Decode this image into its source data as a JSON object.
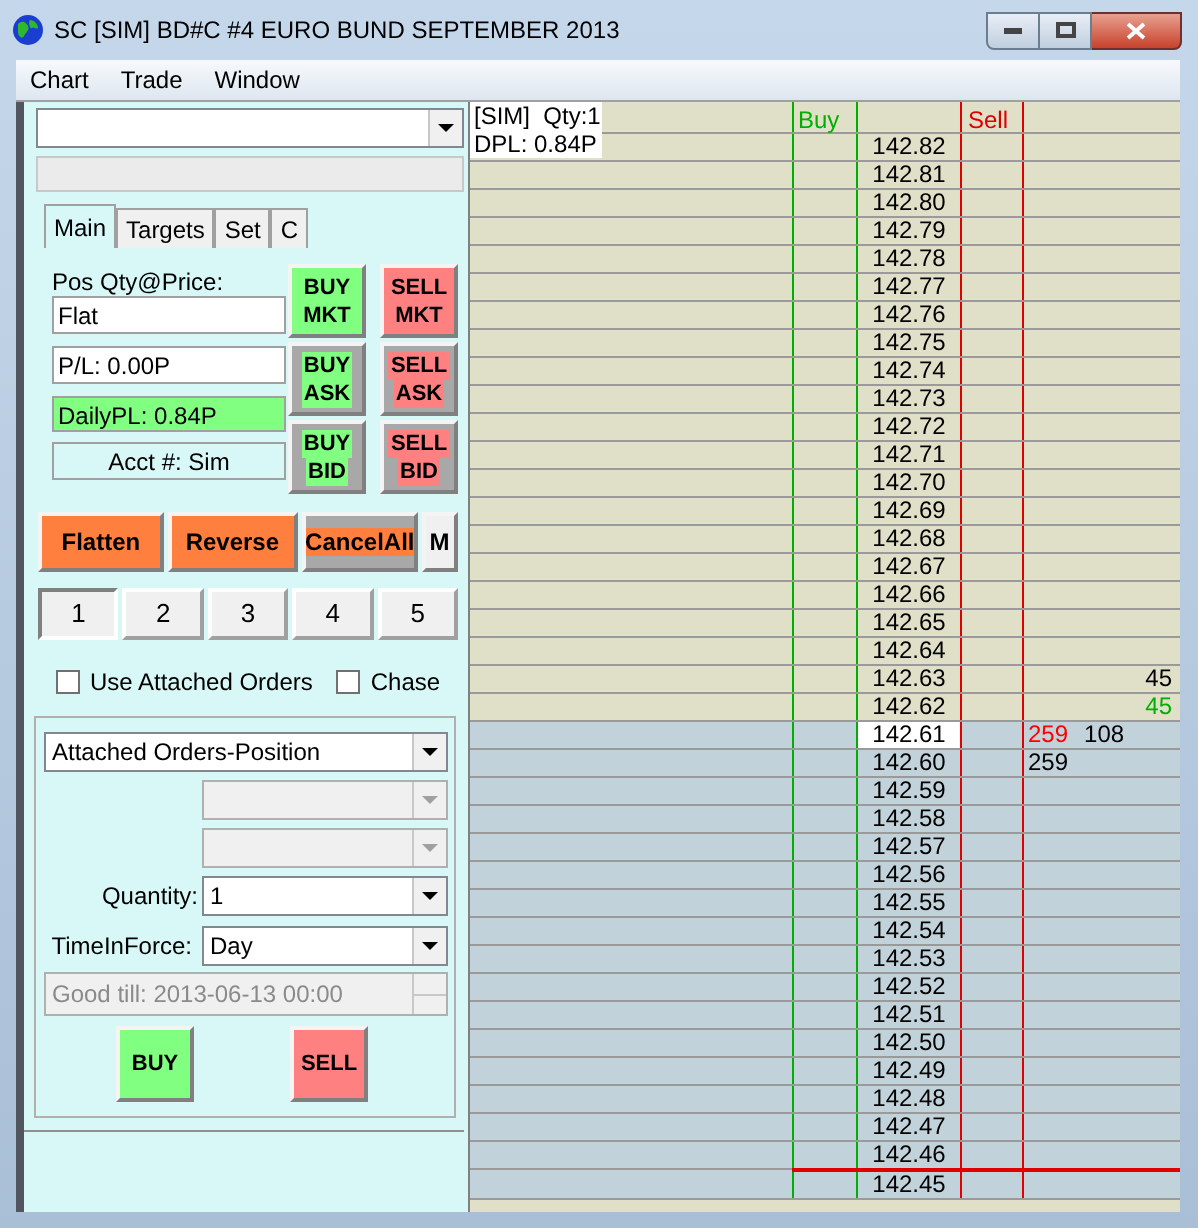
{
  "window": {
    "title": "SC [SIM] BD#C  #4  EURO BUND SEPTEMBER 2013"
  },
  "menu": [
    "Chart",
    "Trade",
    "Window"
  ],
  "left_panel": {
    "tabs": [
      {
        "label": "Main",
        "selected": true
      },
      {
        "label": "Targets",
        "selected": false
      },
      {
        "label": "Set",
        "selected": false
      },
      {
        "label": "C",
        "selected": false
      }
    ],
    "position_label": "Pos Qty@Price:",
    "position_value": "Flat",
    "pl": "P/L: 0.00P",
    "daily_pl": "DailyPL: 0.84P",
    "account": "Acct #: Sim",
    "order_buttons": [
      {
        "lines": [
          "BUY",
          "MKT"
        ],
        "kind": "buy_solid"
      },
      {
        "lines": [
          "SELL",
          "MKT"
        ],
        "kind": "sell_solid"
      },
      {
        "lines": [
          "BUY",
          "ASK"
        ],
        "kind": "buy_highlight"
      },
      {
        "lines": [
          "SELL",
          "ASK"
        ],
        "kind": "sell_highlight"
      },
      {
        "lines": [
          "BUY",
          "BID"
        ],
        "kind": "buy_highlight"
      },
      {
        "lines": [
          "SELL",
          "BID"
        ],
        "kind": "sell_highlight"
      }
    ],
    "action_buttons": [
      {
        "label": "Flatten",
        "kind": "solid"
      },
      {
        "label": "Reverse",
        "kind": "solid"
      },
      {
        "label": "CancelAll",
        "kind": "highlight"
      },
      {
        "label": "M",
        "kind": "plain"
      }
    ],
    "quantity_presets": [
      {
        "label": "1",
        "selected": true
      },
      {
        "label": "2",
        "selected": false
      },
      {
        "label": "3",
        "selected": false
      },
      {
        "label": "4",
        "selected": false
      },
      {
        "label": "5",
        "selected": false
      }
    ],
    "checkboxes": [
      {
        "label": "Use Attached Orders",
        "checked": false
      },
      {
        "label": "Chase",
        "checked": false
      }
    ],
    "attached_orders": {
      "value": "Attached Orders-Position",
      "extra_combos": [
        {
          "disabled": true
        },
        {
          "disabled": true
        }
      ],
      "quantity_label": "Quantity:",
      "quantity_value": "1",
      "tif_label": "TimeInForce:",
      "tif_value": "Day",
      "good_till": "Good till: 2013-06-13 00:00",
      "good_till_disabled": true,
      "buy": "BUY",
      "sell": "SELL"
    }
  },
  "ladder": {
    "info": [
      "[SIM]  Qty:1",
      "DPL: 0.84P"
    ],
    "buy_header": "Buy",
    "sell_header": "Sell",
    "rows": [
      {
        "price": "142.82",
        "kind": "ask",
        "current": false,
        "line_below": false
      },
      {
        "price": "142.81",
        "kind": "ask",
        "current": false,
        "line_below": false
      },
      {
        "price": "142.80",
        "kind": "ask",
        "current": false,
        "line_below": false
      },
      {
        "price": "142.79",
        "kind": "ask",
        "current": false,
        "line_below": false
      },
      {
        "price": "142.78",
        "kind": "ask",
        "current": false,
        "line_below": false
      },
      {
        "price": "142.77",
        "kind": "ask",
        "current": false,
        "line_below": false
      },
      {
        "price": "142.76",
        "kind": "ask",
        "current": false,
        "line_below": false
      },
      {
        "price": "142.75",
        "kind": "ask",
        "current": false,
        "line_below": false
      },
      {
        "price": "142.74",
        "kind": "ask",
        "current": false,
        "line_below": false
      },
      {
        "price": "142.73",
        "kind": "ask",
        "current": false,
        "line_below": false
      },
      {
        "price": "142.72",
        "kind": "ask",
        "current": false,
        "line_below": false
      },
      {
        "price": "142.71",
        "kind": "ask",
        "current": false,
        "line_below": false
      },
      {
        "price": "142.70",
        "kind": "ask",
        "current": false,
        "line_below": false
      },
      {
        "price": "142.69",
        "kind": "ask",
        "current": false,
        "line_below": false
      },
      {
        "price": "142.68",
        "kind": "ask",
        "current": false,
        "line_below": false
      },
      {
        "price": "142.67",
        "kind": "ask",
        "current": false,
        "line_below": false
      },
      {
        "price": "142.66",
        "kind": "ask",
        "current": false,
        "line_below": false
      },
      {
        "price": "142.65",
        "kind": "ask",
        "current": false,
        "line_below": false
      },
      {
        "price": "142.64",
        "kind": "ask",
        "current": false,
        "line_below": false
      },
      {
        "price": "142.63",
        "kind": "ask",
        "current": false,
        "line_below": false,
        "column_5_end": {
          "text": "45",
          "color": "#000000"
        }
      },
      {
        "price": "142.62",
        "kind": "ask",
        "current": false,
        "line_below": false,
        "column_5_end": {
          "text": "45",
          "color": "#00b000"
        }
      },
      {
        "price": "142.61",
        "kind": "bid",
        "current": true,
        "line_below": false,
        "column_5": [
          {
            "text": "259",
            "color": "#ff0000"
          },
          {
            "text": "108",
            "color": "#000000"
          }
        ]
      },
      {
        "price": "142.60",
        "kind": "bid",
        "current": false,
        "line_below": false,
        "column_5": [
          {
            "text": "259",
            "color": "#000000"
          }
        ]
      },
      {
        "price": "142.59",
        "kind": "bid",
        "current": false,
        "line_below": false
      },
      {
        "price": "142.58",
        "kind": "bid",
        "current": false,
        "line_below": false
      },
      {
        "price": "142.57",
        "kind": "bid",
        "current": false,
        "line_below": false
      },
      {
        "price": "142.56",
        "kind": "bid",
        "current": false,
        "line_below": false
      },
      {
        "price": "142.55",
        "kind": "bid",
        "current": false,
        "line_below": false
      },
      {
        "price": "142.54",
        "kind": "bid",
        "current": false,
        "line_below": false
      },
      {
        "price": "142.53",
        "kind": "bid",
        "current": false,
        "line_below": false
      },
      {
        "price": "142.52",
        "kind": "bid",
        "current": false,
        "line_below": false
      },
      {
        "price": "142.51",
        "kind": "bid",
        "current": false,
        "line_below": false
      },
      {
        "price": "142.50",
        "kind": "bid",
        "current": false,
        "line_below": false
      },
      {
        "price": "142.49",
        "kind": "bid",
        "current": false,
        "line_below": false
      },
      {
        "price": "142.48",
        "kind": "bid",
        "current": false,
        "line_below": false
      },
      {
        "price": "142.47",
        "kind": "bid",
        "current": false,
        "line_below": false
      },
      {
        "price": "142.46",
        "kind": "bid",
        "current": false,
        "line_below": true
      },
      {
        "price": "142.45",
        "kind": "bid",
        "current": false,
        "line_below": false
      }
    ]
  }
}
